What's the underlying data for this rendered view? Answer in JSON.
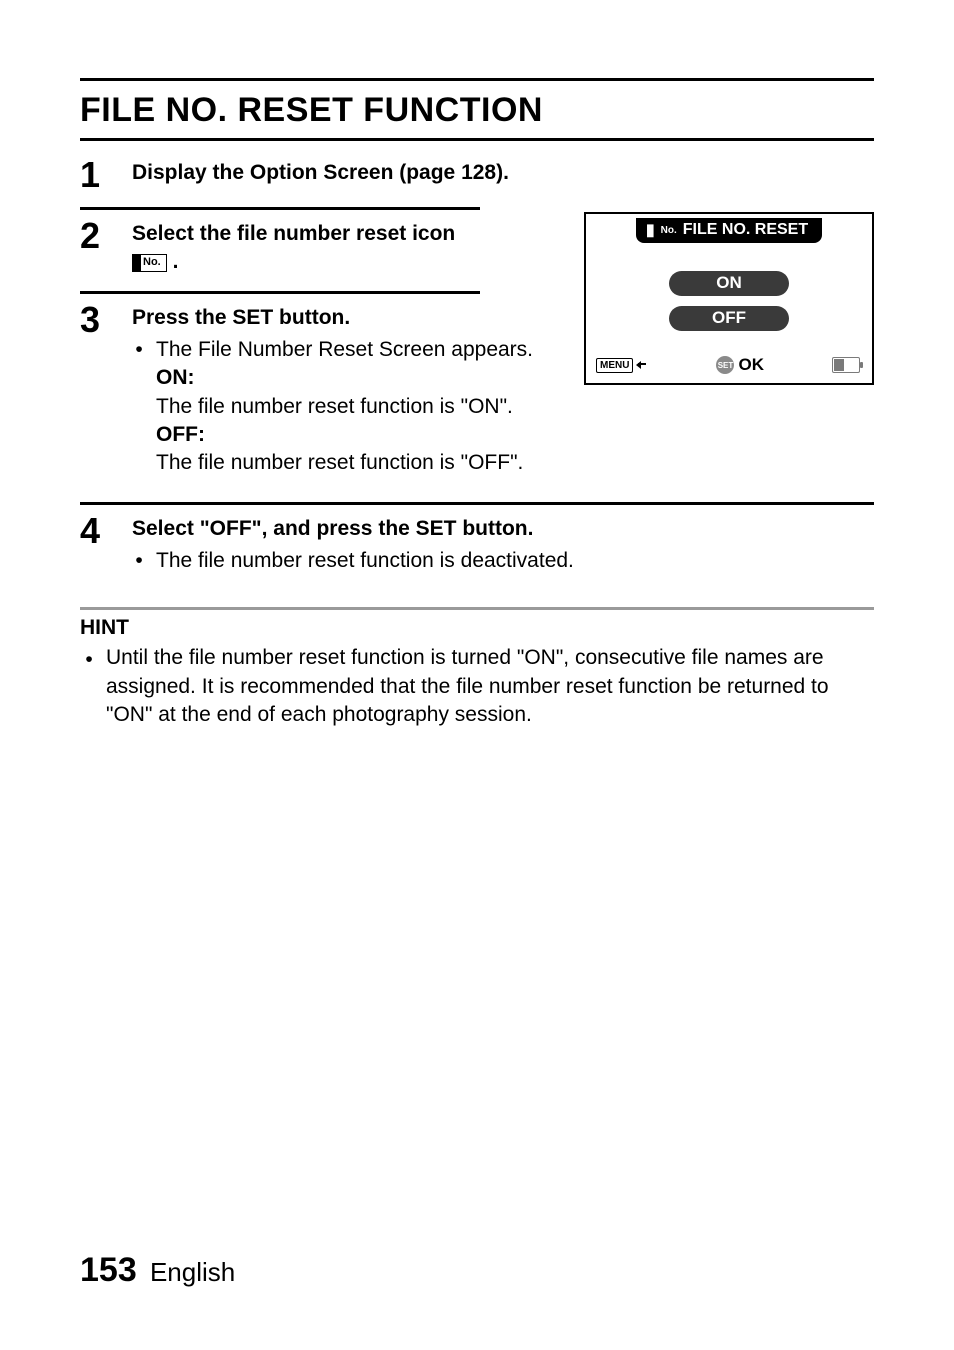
{
  "title": "FILE NO. RESET FUNCTION",
  "steps": {
    "s1": {
      "num": "1",
      "title": "Display the Option Screen (page 128)."
    },
    "s2": {
      "num": "2",
      "title_a": "Select the file number reset icon",
      "title_b": ".",
      "icon_text": "No."
    },
    "s3": {
      "num": "3",
      "title": "Press the SET button.",
      "line1": "The File Number Reset Screen appears.",
      "on_label": "ON:",
      "on_text": "The file number reset function is \"ON\".",
      "off_label": "OFF:",
      "off_text": "The file number reset function is \"OFF\"."
    },
    "s4": {
      "num": "4",
      "title": "Select \"OFF\", and press the SET button.",
      "line1": "The file number reset function is deactivated."
    }
  },
  "screen": {
    "title_small": "No.",
    "title": "FILE NO. RESET",
    "opt_on": "ON",
    "opt_off": "OFF",
    "menu": "MENU",
    "set": "SET",
    "ok": "OK"
  },
  "hint": {
    "heading": "HINT",
    "text": "Until the file number reset function is turned \"ON\", consecutive file names are assigned. It is recommended that the file number reset function be returned to \"ON\" at the end of each photography session."
  },
  "footer": {
    "page": "153",
    "lang": "English"
  }
}
